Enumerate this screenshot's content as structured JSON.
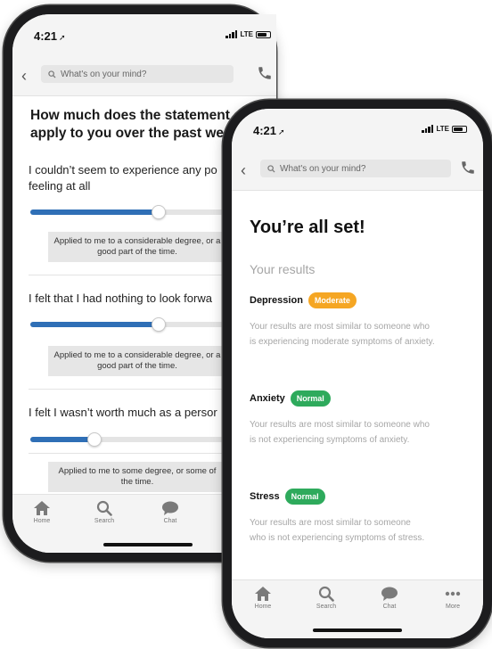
{
  "status_bar": {
    "time": "4:21",
    "network": "LTE"
  },
  "search": {
    "placeholder": "What's on your mind?"
  },
  "questionnaire": {
    "heading": "How much does the statement\napply to you over the past wee",
    "items": [
      {
        "question": "I couldn’t seem to experience any po\nfeeling at all",
        "slider_value": 0.6,
        "answer": "Applied to me to a considerable degree, or a good part of the time."
      },
      {
        "question": "I felt that I had nothing to look forwa",
        "slider_value": 0.6,
        "answer": "Applied to me to a considerable degree, or a good part of the time."
      },
      {
        "question": "I felt I wasn’t worth much as a persor",
        "slider_value": 0.3,
        "answer": "Applied to me to some degree, or some of the time."
      }
    ]
  },
  "results_page": {
    "title": "You’re all set!",
    "subtitle": "Your results",
    "results": [
      {
        "name": "Depression",
        "badge": "Moderate",
        "badge_color": "#f5a623",
        "description": "Your results are most similar to someone who\nis experiencing moderate symptoms of anxiety."
      },
      {
        "name": "Anxiety",
        "badge": "Normal",
        "badge_color": "#2eaa5c",
        "description": "Your results are most similar to someone who\nis not experiencing symptoms of anxiety."
      },
      {
        "name": "Stress",
        "badge": "Normal",
        "badge_color": "#2eaa5c",
        "description": "Your results are most similar to someone\nwho is not experiencing symptoms of stress."
      }
    ]
  },
  "tabs": {
    "home": "Home",
    "search": "Search",
    "chat": "Chat",
    "more": "More"
  },
  "colors": {
    "slider_fill": "#2f6fb6",
    "moderate": "#f5a623",
    "normal": "#2eaa5c"
  }
}
